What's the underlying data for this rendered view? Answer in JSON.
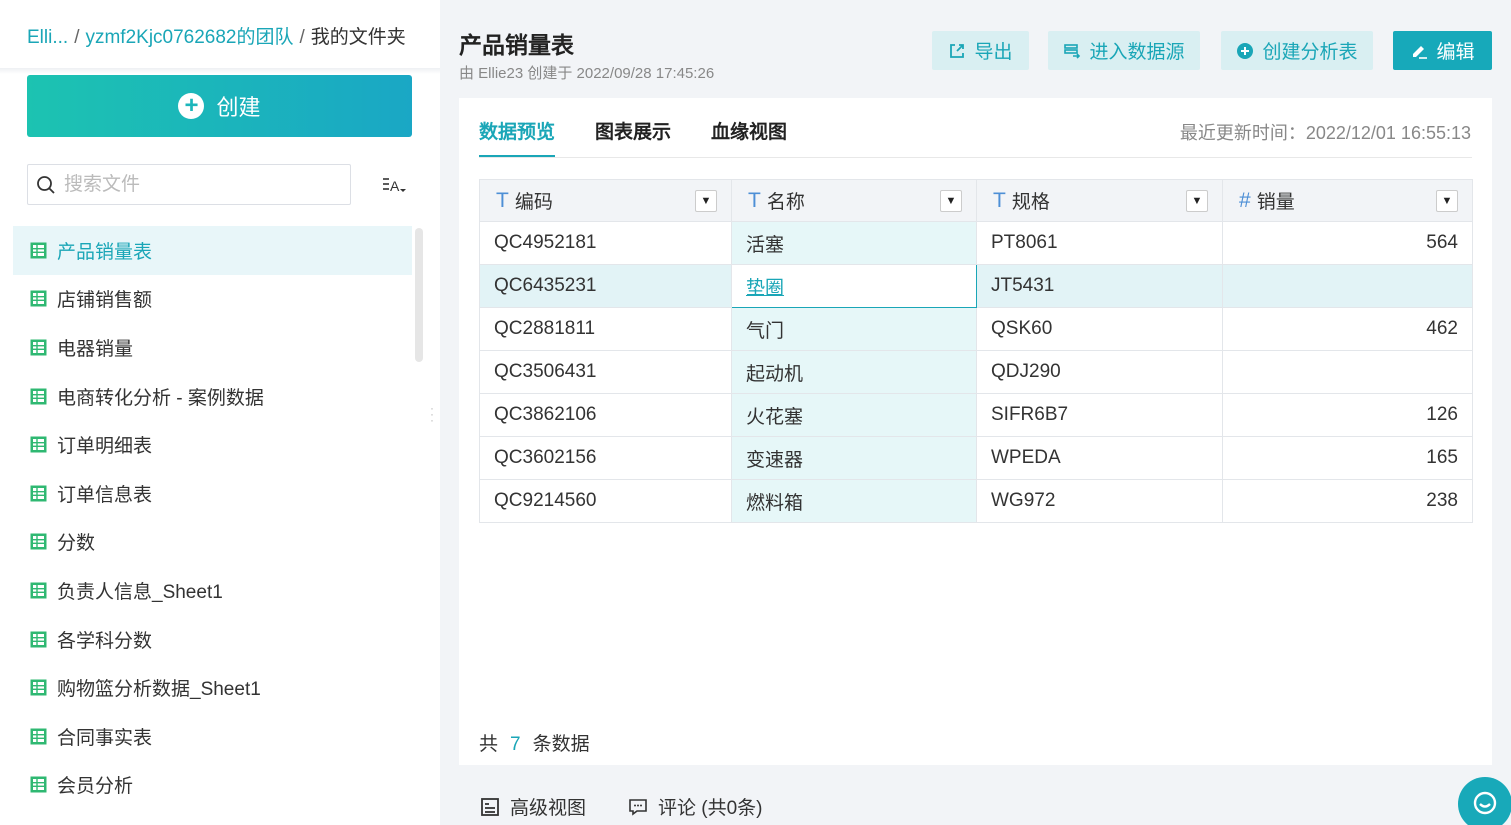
{
  "breadcrumb": {
    "root": "Elli...",
    "team": "yzmf2Kjc0762682的团队",
    "current": "我的文件夹",
    "sep": "/"
  },
  "sidebar": {
    "create_label": "创建",
    "search_placeholder": "搜索文件",
    "files": [
      {
        "label": "产品销量表",
        "active": true
      },
      {
        "label": "店铺销售额"
      },
      {
        "label": "电器销量"
      },
      {
        "label": "电商转化分析 - 案例数据"
      },
      {
        "label": "订单明细表"
      },
      {
        "label": "订单信息表"
      },
      {
        "label": "分数"
      },
      {
        "label": "负责人信息_Sheet1"
      },
      {
        "label": "各学科分数"
      },
      {
        "label": "购物篮分析数据_Sheet1"
      },
      {
        "label": "合同事实表"
      },
      {
        "label": "会员分析"
      }
    ]
  },
  "header": {
    "title": "产品销量表",
    "subtitle": "由 Ellie23 创建于 2022/09/28 17:45:26",
    "buttons": {
      "export": "导出",
      "datasource": "进入数据源",
      "create_analysis": "创建分析表",
      "edit": "编辑"
    }
  },
  "tabs": [
    "数据预览",
    "图表展示",
    "血缘视图"
  ],
  "update_time": "最近更新时间：2022/12/01 16:55:13",
  "table": {
    "columns": [
      {
        "type": "T",
        "label": "编码"
      },
      {
        "type": "T",
        "label": "名称"
      },
      {
        "type": "T",
        "label": "规格"
      },
      {
        "type": "#",
        "label": "销量"
      }
    ],
    "rows": [
      [
        "QC4952181",
        "活塞",
        "PT8061",
        "564"
      ],
      [
        "QC6435231",
        "垫圈",
        "JT5431",
        ""
      ],
      [
        "QC2881811",
        "气门",
        "QSK60",
        "462"
      ],
      [
        "QC3506431",
        "起动机",
        "QDJ290",
        ""
      ],
      [
        "QC3862106",
        "火花塞",
        "SIFR6B7",
        "126"
      ],
      [
        "QC3602156",
        "变速器",
        "WPEDA",
        "165"
      ],
      [
        "QC9214560",
        "燃料箱",
        "WG972",
        "238"
      ]
    ]
  },
  "count": {
    "prefix": "共",
    "value": "7",
    "suffix": "条数据"
  },
  "bottom": {
    "advanced_view": "高级视图",
    "comments": "评论 (共0条)"
  },
  "colors": {
    "accent": "#1aa6b7",
    "active_bg": "#e8f6f9",
    "name_col_bg": "#e6f7f8"
  }
}
